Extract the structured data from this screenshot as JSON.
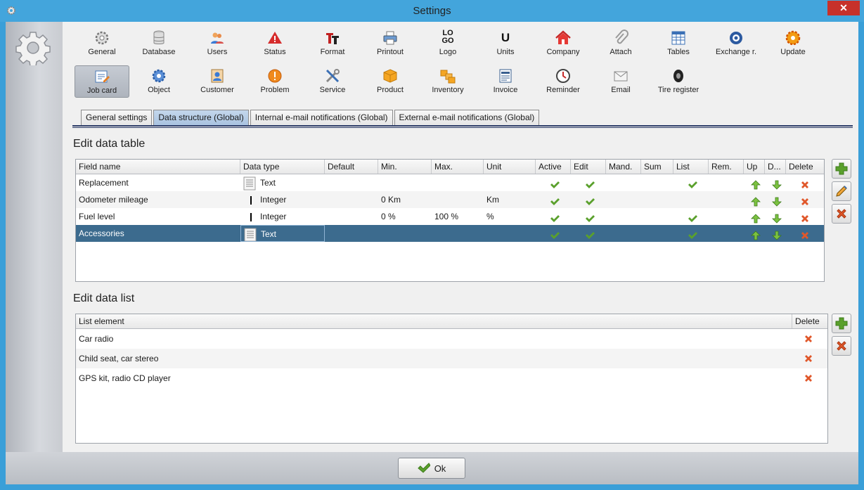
{
  "window": {
    "title": "Settings",
    "close_label": "✕"
  },
  "toolbar": {
    "row1": [
      {
        "label": "General",
        "icon": "gear-icon"
      },
      {
        "label": "Database",
        "icon": "database-icon"
      },
      {
        "label": "Users",
        "icon": "users-icon"
      },
      {
        "label": "Status",
        "icon": "warning-icon"
      },
      {
        "label": "Format",
        "icon": "format-icon"
      },
      {
        "label": "Printout",
        "icon": "printer-icon"
      },
      {
        "label": "Logo",
        "icon": "logo-icon"
      },
      {
        "label": "Units",
        "icon": "units-icon"
      },
      {
        "label": "Company",
        "icon": "house-icon"
      },
      {
        "label": "Attach",
        "icon": "paperclip-icon"
      },
      {
        "label": "Tables",
        "icon": "table-icon"
      },
      {
        "label": "Exchange r.",
        "icon": "exchange-icon"
      },
      {
        "label": "Update",
        "icon": "update-icon"
      }
    ],
    "row2": [
      {
        "label": "Job card",
        "icon": "job-card-icon",
        "active": true
      },
      {
        "label": "Object",
        "icon": "object-gear-icon"
      },
      {
        "label": "Customer",
        "icon": "customer-icon"
      },
      {
        "label": "Problem",
        "icon": "problem-icon"
      },
      {
        "label": "Service",
        "icon": "tools-icon"
      },
      {
        "label": "Product",
        "icon": "box-icon"
      },
      {
        "label": "Inventory",
        "icon": "boxes-icon"
      },
      {
        "label": "Invoice",
        "icon": "invoice-icon"
      },
      {
        "label": "Reminder",
        "icon": "clock-icon"
      },
      {
        "label": "Email",
        "icon": "envelope-icon"
      },
      {
        "label": "Tire register",
        "icon": "tire-icon"
      }
    ],
    "logo_text_top": "LO",
    "logo_text_bottom": "GO",
    "units_text": "U"
  },
  "tabs": [
    {
      "label": "General settings",
      "active": false
    },
    {
      "label": "Data structure (Global)",
      "active": true
    },
    {
      "label": "Internal e-mail notifications (Global)",
      "active": false
    },
    {
      "label": "External e-mail notifications (Global)",
      "active": false
    }
  ],
  "data_table": {
    "title": "Edit data table",
    "columns": [
      "Field name",
      "Data type",
      "Default",
      "Min.",
      "Max.",
      "Unit",
      "Active",
      "Edit",
      "Mand.",
      "Sum",
      "List",
      "Rem.",
      "Up",
      "D...",
      "Delete"
    ],
    "rows": [
      {
        "field": "Replacement",
        "type": "Text",
        "type_icon": "text-doc-icon",
        "default": "",
        "min": "",
        "max": "",
        "unit": "",
        "active": true,
        "edit": true,
        "mand": false,
        "sum": false,
        "list": true,
        "rem": false,
        "selected": false
      },
      {
        "field": "Odometer mileage",
        "type": "Integer",
        "type_icon": "integer-bar-icon",
        "default": "",
        "min": "0 Km",
        "max": "",
        "unit": "Km",
        "active": true,
        "edit": true,
        "mand": false,
        "sum": false,
        "list": false,
        "rem": false,
        "selected": false
      },
      {
        "field": "Fuel level",
        "type": "Integer",
        "type_icon": "integer-bar-icon",
        "default": "",
        "min": "0 %",
        "max": "100 %",
        "unit": "%",
        "active": true,
        "edit": true,
        "mand": false,
        "sum": false,
        "list": true,
        "rem": false,
        "selected": false
      },
      {
        "field": "Accessories",
        "type": "Text",
        "type_icon": "text-doc-icon",
        "default": "",
        "min": "",
        "max": "",
        "unit": "",
        "active": true,
        "edit": true,
        "mand": false,
        "sum": false,
        "list": true,
        "rem": false,
        "selected": true
      }
    ]
  },
  "data_list": {
    "title": "Edit data list",
    "columns": [
      "List element",
      "Delete"
    ],
    "rows": [
      "Car radio",
      "Child seat, car stereo",
      "GPS kit, radio CD player"
    ]
  },
  "buttons": {
    "ok_label": "Ok"
  },
  "colors": {
    "selection": "#3c6b8e",
    "check": "#5aa02c",
    "delete": "#e0572a",
    "titlebar": "#43a5dc"
  }
}
